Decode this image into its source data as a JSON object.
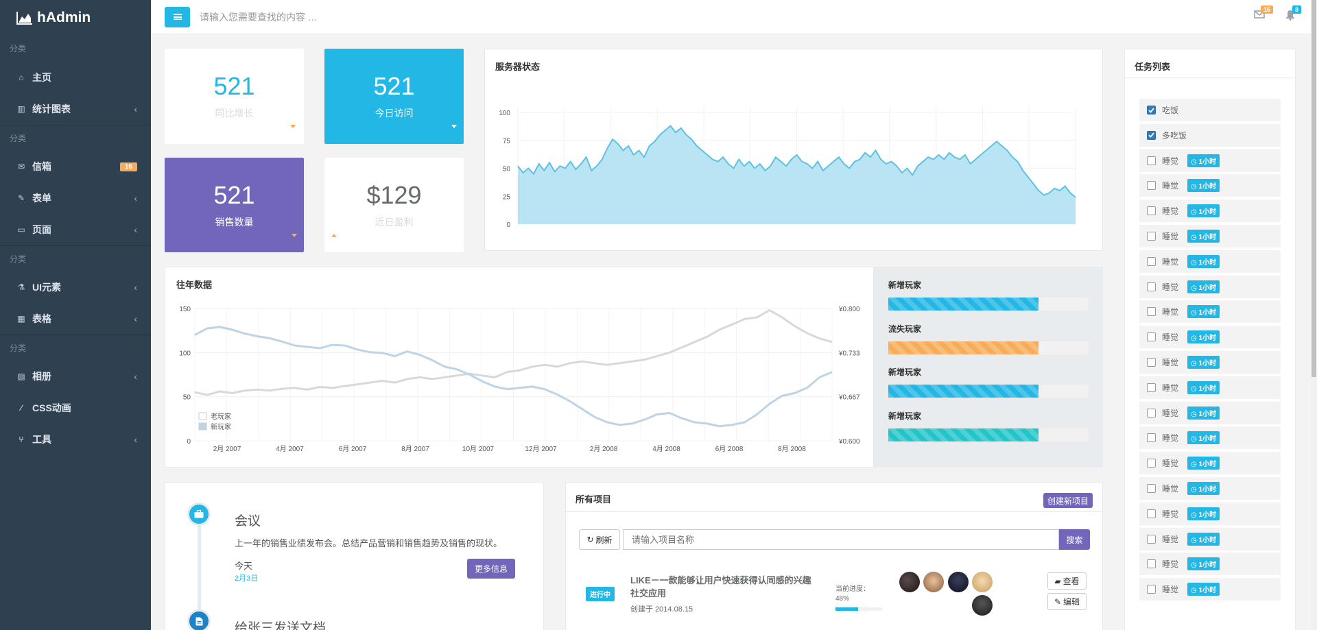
{
  "app": {
    "logo": "hAdmin"
  },
  "sidebar": {
    "sections": [
      "分类",
      "分类",
      "分类",
      "分类"
    ],
    "items": [
      {
        "label": "主页",
        "icon": "home-icon",
        "arrow": ""
      },
      {
        "label": "统计图表",
        "icon": "bar-chart-icon",
        "arrow": "‹"
      },
      {
        "label": "信箱",
        "icon": "envelope-icon",
        "badge": "16"
      },
      {
        "label": "表单",
        "icon": "edit-icon",
        "arrow": "‹"
      },
      {
        "label": "页面",
        "icon": "desktop-icon",
        "arrow": "‹"
      },
      {
        "label": "UI元素",
        "icon": "flask-icon",
        "arrow": "‹"
      },
      {
        "label": "表格",
        "icon": "table-icon",
        "arrow": "‹"
      },
      {
        "label": "相册",
        "icon": "picture-icon",
        "arrow": "‹"
      },
      {
        "label": "CSS动画",
        "icon": "magic-icon",
        "arrow": ""
      },
      {
        "label": "工具",
        "icon": "cutlery-icon",
        "arrow": "‹"
      }
    ]
  },
  "topbar": {
    "search_placeholder": "请输入您需要查找的内容 …",
    "mail_badge": "16",
    "bell_badge": "8"
  },
  "stats": [
    {
      "value": "521",
      "label": "同比增长"
    },
    {
      "value": "521",
      "label": "今日访问"
    },
    {
      "value": "521",
      "label": "销售数量"
    },
    {
      "value": "$129",
      "label": "近日盈利"
    }
  ],
  "server_panel": {
    "title": "服务器状态",
    "chart_data": {
      "type": "area",
      "title": "",
      "ylim": [
        0,
        100
      ],
      "yticks": [
        "100",
        "75",
        "50",
        "25",
        "0"
      ],
      "grid": true,
      "series": [
        {
          "values": [
            52,
            46,
            50,
            45,
            54,
            48,
            55,
            47,
            52,
            50,
            56,
            49,
            54,
            60,
            48,
            52,
            58,
            68,
            76,
            72,
            66,
            70,
            62,
            66,
            60,
            70,
            74,
            80,
            84,
            88,
            82,
            86,
            80,
            76,
            70,
            66,
            62,
            58,
            56,
            60,
            54,
            50,
            58,
            52,
            56,
            50,
            54,
            48,
            52,
            60,
            56,
            52,
            58,
            62,
            56,
            54,
            50,
            56,
            48,
            52,
            56,
            60,
            54,
            50,
            56,
            58,
            64,
            60,
            66,
            58,
            54,
            56,
            52,
            46,
            50,
            44,
            52,
            56,
            60,
            58,
            62,
            58,
            64,
            60,
            58,
            62,
            54,
            58,
            62,
            66,
            70,
            74,
            70,
            66,
            60,
            56,
            48,
            42,
            36,
            30,
            26,
            28,
            32,
            30,
            34,
            28,
            24
          ]
        }
      ]
    }
  },
  "yearly_panel": {
    "title": "往年数据",
    "chart_data": {
      "type": "line",
      "title": "",
      "x_ticks": [
        "2月 2007",
        "4月 2007",
        "6月 2007",
        "8月 2007",
        "10月 2007",
        "12月 2007",
        "2月 2008",
        "4月 2008",
        "6月 2008",
        "8月 2008"
      ],
      "y_left_ticks": [
        "150",
        "100",
        "50",
        "0"
      ],
      "y_right_ticks": [
        "¥0.800",
        "¥0.733",
        "¥0.667",
        "¥0.600"
      ],
      "ylim_left": [
        0,
        150
      ],
      "ylim_right": [
        0.6,
        0.8
      ],
      "grid": true,
      "legend_position": "bottom-left",
      "series": [
        {
          "name": "老玩家",
          "axis": "left",
          "values": [
            55,
            52,
            56,
            54,
            57,
            58,
            57,
            59,
            60,
            58,
            61,
            60,
            62,
            64,
            66,
            68,
            66,
            70,
            72,
            70,
            72,
            74,
            76,
            74,
            72,
            78,
            80,
            84,
            86,
            84,
            88,
            90,
            88,
            86,
            88,
            90,
            92,
            96,
            100,
            106,
            112,
            118,
            126,
            132,
            138,
            140,
            148,
            140,
            130,
            122,
            116,
            112
          ]
        },
        {
          "name": "新玩家",
          "axis": "right",
          "values": [
            0.76,
            0.77,
            0.772,
            0.768,
            0.762,
            0.758,
            0.755,
            0.75,
            0.744,
            0.742,
            0.74,
            0.745,
            0.744,
            0.738,
            0.734,
            0.733,
            0.728,
            0.735,
            0.73,
            0.722,
            0.712,
            0.708,
            0.7,
            0.69,
            0.682,
            0.678,
            0.68,
            0.682,
            0.678,
            0.67,
            0.66,
            0.648,
            0.636,
            0.628,
            0.624,
            0.626,
            0.632,
            0.64,
            0.642,
            0.634,
            0.628,
            0.626,
            0.622,
            0.624,
            0.628,
            0.64,
            0.656,
            0.668,
            0.672,
            0.68,
            0.696,
            0.704
          ]
        }
      ]
    }
  },
  "progress": [
    {
      "label": "新增玩家",
      "value": 75,
      "color": "#23b7e5"
    },
    {
      "label": "流失玩家",
      "value": 75,
      "color": "#f8ac59"
    },
    {
      "label": "新增玩家",
      "value": 75,
      "color": "#23b7e5"
    },
    {
      "label": "新增玩家",
      "value": 75,
      "color": "#23c6c8"
    }
  ],
  "timeline": [
    {
      "title": "会议",
      "desc": "上一年的销售业绩发布会。总结产品营销和销售趋势及销售的现状。",
      "day": "今天",
      "date": "2月3日",
      "button": "更多信息"
    },
    {
      "title": "给张三发送文档"
    }
  ],
  "projects": {
    "title": "所有项目",
    "create_button": "创建新项目",
    "refresh_button": "刷新",
    "search_placeholder": "请输入项目名称",
    "search_button": "搜索",
    "rows": [
      {
        "status": "进行中",
        "name": "LIKE－一款能够让用户快速获得认同感的兴趣社交应用",
        "created": "创建于 2014.08.15",
        "progress_label": "当前进度：",
        "progress_text": "48%",
        "progress": 48,
        "view": "查看",
        "edit": "编辑"
      }
    ]
  },
  "tasks": {
    "title": "任务列表",
    "items": [
      {
        "label": "吃饭",
        "checked": true,
        "tag": ""
      },
      {
        "label": "多吃饭",
        "checked": true,
        "tag": ""
      },
      {
        "label": "睡觉",
        "checked": false,
        "tag": "1小时"
      },
      {
        "label": "睡觉",
        "checked": false,
        "tag": "1小时"
      },
      {
        "label": "睡觉",
        "checked": false,
        "tag": "1小时"
      },
      {
        "label": "睡觉",
        "checked": false,
        "tag": "1小时"
      },
      {
        "label": "睡觉",
        "checked": false,
        "tag": "1小时"
      },
      {
        "label": "睡觉",
        "checked": false,
        "tag": "1小时"
      },
      {
        "label": "睡觉",
        "checked": false,
        "tag": "1小时"
      },
      {
        "label": "睡觉",
        "checked": false,
        "tag": "1小时"
      },
      {
        "label": "睡觉",
        "checked": false,
        "tag": "1小时"
      },
      {
        "label": "睡觉",
        "checked": false,
        "tag": "1小时"
      },
      {
        "label": "睡觉",
        "checked": false,
        "tag": "1小时"
      },
      {
        "label": "睡觉",
        "checked": false,
        "tag": "1小时"
      },
      {
        "label": "睡觉",
        "checked": false,
        "tag": "1小时"
      },
      {
        "label": "睡觉",
        "checked": false,
        "tag": "1小时"
      },
      {
        "label": "睡觉",
        "checked": false,
        "tag": "1小时"
      },
      {
        "label": "睡觉",
        "checked": false,
        "tag": "1小时"
      },
      {
        "label": "睡觉",
        "checked": false,
        "tag": "1小时"
      },
      {
        "label": "睡觉",
        "checked": false,
        "tag": "1小时"
      }
    ]
  }
}
